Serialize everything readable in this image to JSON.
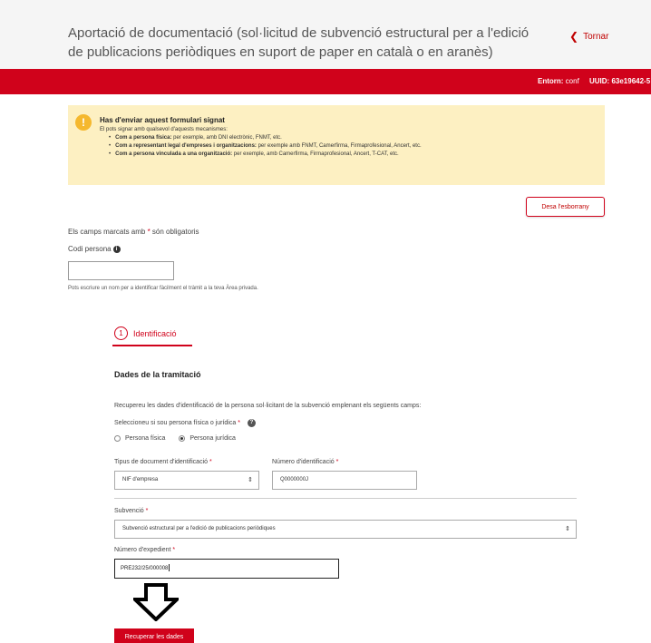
{
  "header": {
    "title": "Aportació de documentació (sol·licitud de subvenció estructural per a l'edició de publicacions periòdiques en suport de paper en català o en aranès)",
    "back_label": "Tornar"
  },
  "env_bar": {
    "env_label": "Entorn:",
    "env_value": "conf",
    "uuid_text": "UUID: 63e19642-5"
  },
  "alert": {
    "title": "Has d'enviar aquest formulari signat",
    "intro": "El pots signar amb qualsevol d'aquests mecanismes:",
    "items": [
      {
        "lead": "Com a persona física:",
        "text": " per exemple, amb DNI electrònic, FNMT, etc."
      },
      {
        "lead": "Com a representant legal d'empreses i organitzacions:",
        "text": " per exemple amb FNMT, Camerfirma, Firmaprofesional, Ancert, etc."
      },
      {
        "lead": "Com a persona vinculada a una organització:",
        "text": " per exemple, amb Camerfirma, Firmaprofesional, Ancert, T-CAT, etc."
      }
    ]
  },
  "toolbar": {
    "save_draft_label": "Desa l'esborrany"
  },
  "form": {
    "required_note_prefix": "Els camps marcats amb ",
    "required_star": "*",
    "required_note_suffix": " són obligatoris",
    "codi_label": "Codi persona",
    "codi_value": "",
    "codi_help": "Pots escriure un nom per a identificar fàcilment el tràmit a la teva Àrea privada."
  },
  "step": {
    "number": "1",
    "label": "Identificació"
  },
  "section": {
    "title": "Dades de la tramitació",
    "recover_desc": "Recupereu les dades d'identificació de la persona sol·licitant de la subvenció emplenant els següents camps:",
    "type_question": "Seleccioneu si sou persona física o jurídica",
    "radio_fisica": "Persona física",
    "radio_juridica": "Persona jurídica",
    "selected_type": "juridica",
    "doc_type_label": "Tipus de document d'identificació",
    "doc_type_value": "NIF d'empresa",
    "doc_number_label": "Número d'identificació",
    "doc_number_value": "Q0000000J",
    "subv_label": "Subvenció",
    "subv_value": "Subvenció estructural per a l'edició de publicacions periòdiques",
    "exp_label": "Número d'expedient",
    "exp_value": "PRE232/25/000008",
    "recover_button": "Recuperar les dades"
  },
  "icons": {
    "back": "chevron-left-icon",
    "alert": "exclamation-icon",
    "info": "info-icon",
    "help": "question-icon",
    "select": "sort-arrows-icon",
    "arrow": "arrow-down-icon"
  },
  "colors": {
    "brand_red": "#d0021b",
    "alert_bg": "#fdf0c2",
    "alert_icon": "#f5b82e",
    "header_bg": "#f5f5f5"
  }
}
